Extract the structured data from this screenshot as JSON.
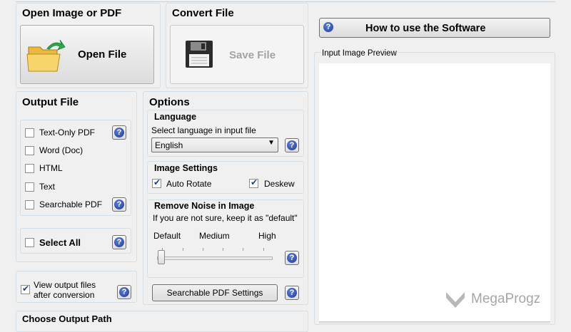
{
  "open_section": {
    "title": "Open Image or PDF",
    "open_button": "Open File"
  },
  "convert_section": {
    "title": "Convert File",
    "save_button": "Save File"
  },
  "how_to_button": "How to use the Software",
  "preview": {
    "label": "Input Image Preview"
  },
  "output_file": {
    "title": "Output File",
    "options": [
      {
        "label": "Text-Only PDF",
        "checked": false
      },
      {
        "label": "Word (Doc)",
        "checked": false
      },
      {
        "label": "HTML",
        "checked": false
      },
      {
        "label": "Text",
        "checked": false
      },
      {
        "label": "Searchable PDF",
        "checked": false
      }
    ],
    "select_all": "Select All"
  },
  "view_output": {
    "line1": "View output files",
    "line2": "after conversion",
    "checked": true
  },
  "options": {
    "title": "Options",
    "language": {
      "title": "Language",
      "hint": "Select language in input file",
      "selected": "English"
    },
    "image_settings": {
      "title": "Image Settings",
      "auto_rotate": "Auto Rotate",
      "deskew": "Deskew",
      "auto_rotate_checked": true,
      "deskew_checked": true
    },
    "noise": {
      "title": "Remove Noise in Image",
      "hint": "If you are not sure, keep it as \"default\"",
      "default_label": "Default",
      "medium_label": "Medium",
      "high_label": "High",
      "level": 0
    },
    "searchable_pdf_settings": "Searchable PDF Settings"
  },
  "output_path": {
    "title": "Choose Output Path"
  },
  "watermark": "MegaProgz"
}
